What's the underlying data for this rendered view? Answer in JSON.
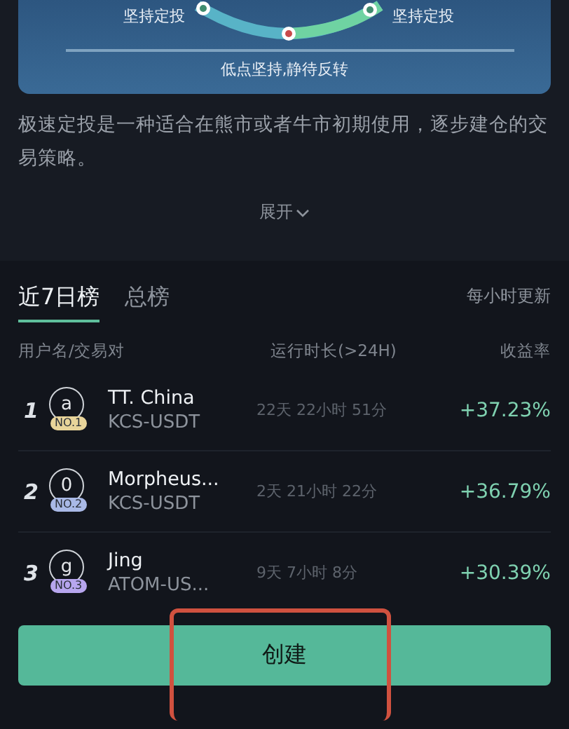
{
  "chart": {
    "left_label": "坚持定投",
    "right_label": "坚持定投",
    "bottom_label": "低点坚持,静待反转"
  },
  "description": "极速定投是一种适合在熊市或者牛市初期使用，逐步建仓的交易策略。",
  "expand": {
    "label": "展开",
    "expanded": false
  },
  "tabs": [
    {
      "label": "近7日榜",
      "selected": true
    },
    {
      "label": "总榜",
      "selected": false
    }
  ],
  "update_note": "每小时更新",
  "columns": [
    "用户名/交易对",
    "运行时长(>24H)",
    "收益率"
  ],
  "rows": [
    {
      "rank": "1",
      "avatar": "a",
      "badge": "NO.1",
      "color": "#e8d49a",
      "name": "TT. China",
      "pair": "KCS-USDT",
      "duration": "22天 22小时 51分",
      "return": "+37.23%"
    },
    {
      "rank": "2",
      "avatar": "0",
      "badge": "NO.2",
      "color": "#a9b9e6",
      "name": "Morpheus...",
      "pair": "KCS-USDT",
      "duration": "2天 21小时 22分",
      "return": "+36.79%"
    },
    {
      "rank": "3",
      "avatar": "g",
      "badge": "NO.3",
      "color": "#b7a6ee",
      "name": "Jing",
      "pair": "ATOM-US...",
      "duration": "9天 7小时 8分",
      "return": "+30.39%"
    }
  ],
  "create_button": "创建"
}
